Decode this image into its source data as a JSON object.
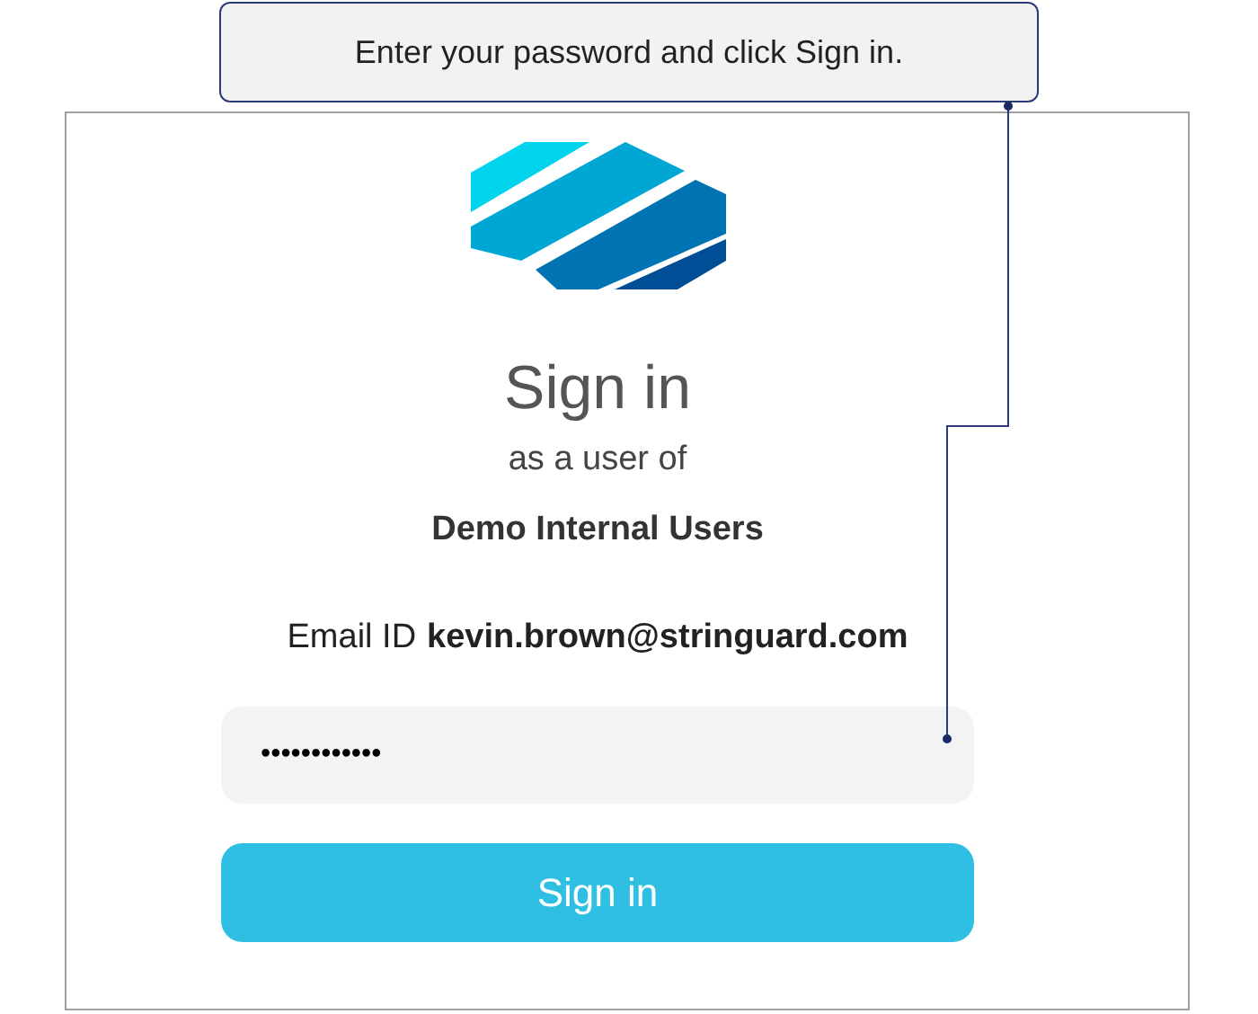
{
  "callout": {
    "text": "Enter your password and click Sign in."
  },
  "signin": {
    "title": "Sign in",
    "subtitle": "as a user of",
    "organization": "Demo Internal Users",
    "email_label": "Email ID",
    "email": "kevin.brown@stringuard.com",
    "password": {
      "value": "••••••••••••"
    },
    "button": "Sign in"
  }
}
